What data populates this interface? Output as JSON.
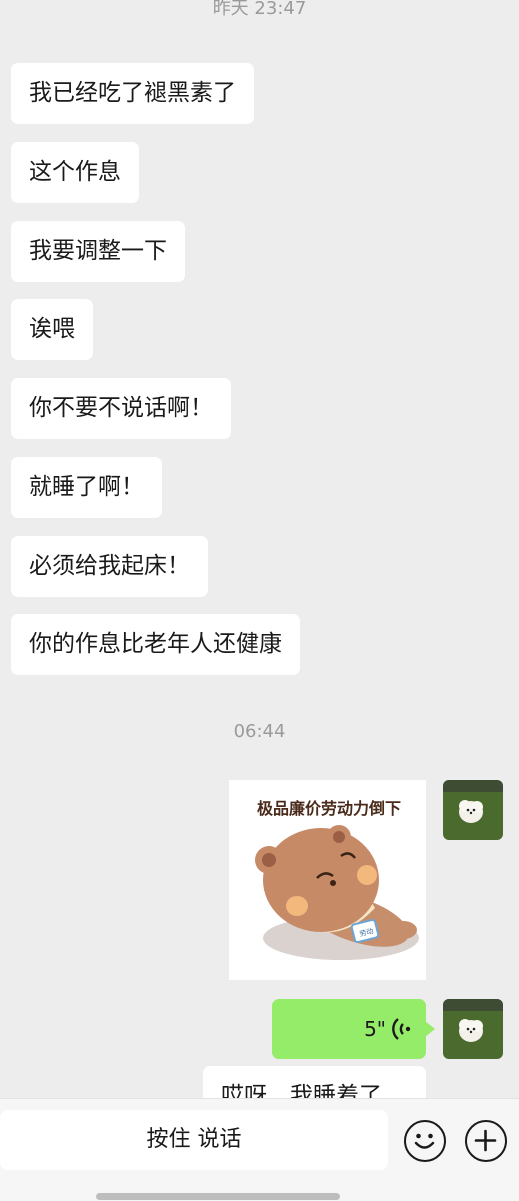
{
  "chat": {
    "timestamp_top": "昨天 23:47",
    "timestamp_mid": "06:44",
    "incoming": [
      "我已经吃了褪黑素了",
      "这个作息",
      "我要调整一下",
      "诶喂",
      "你不要不说话啊！",
      "就睡了啊！",
      "必须给我起床！",
      "你的作息比老年人还健康"
    ],
    "sticker": {
      "caption": "极品廉价劳动力倒下",
      "badge": "劳动"
    },
    "voice": {
      "duration": "5\""
    },
    "partial_message": "哎呀，我睡着了"
  },
  "input_bar": {
    "hold_to_talk": "按住 说话",
    "emoji_icon": "smiley-face-icon",
    "plus_icon": "plus-circle-icon"
  },
  "colors": {
    "background": "#ededed",
    "incoming_bubble": "#ffffff",
    "outgoing_bubble": "#95ec69",
    "timestamp": "#9a9a9a"
  }
}
